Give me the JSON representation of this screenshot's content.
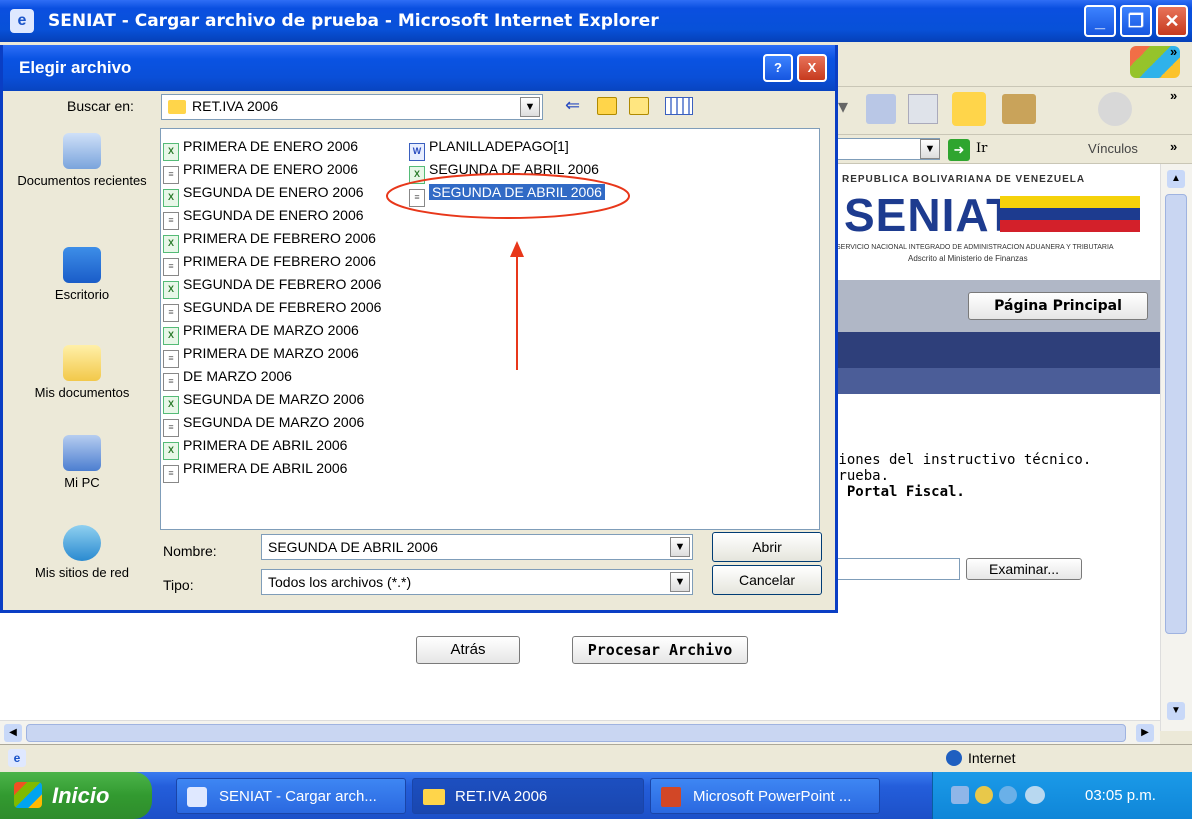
{
  "ie": {
    "title": "SENIAT - Cargar archivo de prueba - Microsoft Internet Explorer",
    "go_label": "Ir",
    "links_label": "Vínculos",
    "status_zone": "Internet"
  },
  "webpage": {
    "banner_top": "REPUBLICA BOLIVARIANA DE VENEZUELA",
    "banner_logo": "SENIAT",
    "banner_sub": "SERVICIO NACIONAL INTEGRADO DE ADMINISTRACION ADUANERA Y TRIBUTARIA",
    "banner_sub2": "Adscrito al Ministerio de Finanzas",
    "main_button": "Página Principal",
    "text_line1": "ciones del instructivo técnico.",
    "text_line2": "prueba.",
    "text_line3": "l Portal Fiscal.",
    "examinar_button": "Examinar...",
    "back_button": "Atrás",
    "process_button": "Procesar Archivo"
  },
  "dialog": {
    "title": "Elegir archivo",
    "help": "?",
    "close": "X",
    "lookin_label": "Buscar en:",
    "lookin_value": "RET.IVA 2006",
    "places": [
      {
        "label": "Documentos recientes"
      },
      {
        "label": "Escritorio"
      },
      {
        "label": "Mis documentos"
      },
      {
        "label": "Mi PC"
      },
      {
        "label": "Mis sitios de red"
      }
    ],
    "files_col1": [
      {
        "name": "PRIMERA DE ENERO 2006",
        "type": "xls"
      },
      {
        "name": "PRIMERA DE ENERO 2006",
        "type": "txt"
      },
      {
        "name": "SEGUNDA DE ENERO 2006",
        "type": "xls"
      },
      {
        "name": "SEGUNDA DE ENERO 2006",
        "type": "txt"
      },
      {
        "name": "PRIMERA DE FEBRERO 2006",
        "type": "xls"
      },
      {
        "name": "PRIMERA DE FEBRERO 2006",
        "type": "txt"
      },
      {
        "name": "SEGUNDA DE FEBRERO 2006",
        "type": "xls"
      },
      {
        "name": "SEGUNDA DE FEBRERO 2006",
        "type": "txt"
      },
      {
        "name": "PRIMERA DE MARZO 2006",
        "type": "xls"
      },
      {
        "name": "PRIMERA DE MARZO 2006",
        "type": "txt"
      },
      {
        "name": "DE MARZO 2006",
        "type": "txt"
      },
      {
        "name": "SEGUNDA DE MARZO 2006",
        "type": "xls"
      },
      {
        "name": "SEGUNDA DE MARZO 2006",
        "type": "txt"
      },
      {
        "name": "PRIMERA DE ABRIL 2006",
        "type": "xls"
      },
      {
        "name": "PRIMERA DE ABRIL 2006",
        "type": "txt"
      }
    ],
    "files_col2": [
      {
        "name": "PLANILLADEPAGO[1]",
        "type": "doc"
      },
      {
        "name": "SEGUNDA DE ABRIL 2006",
        "type": "xls"
      },
      {
        "name": "SEGUNDA DE ABRIL 2006",
        "type": "txt",
        "selected": true
      }
    ],
    "filename_label": "Nombre:",
    "filename_value": "SEGUNDA DE ABRIL 2006",
    "filetype_label": "Tipo:",
    "filetype_value": "Todos los archivos (*.*)",
    "open_button": "Abrir",
    "cancel_button": "Cancelar",
    "annotation_color": "#e8371a"
  },
  "taskbar": {
    "start": "Inicio",
    "tasks": [
      {
        "label": "SENIAT - Cargar arch..."
      },
      {
        "label": "RET.IVA 2006"
      },
      {
        "label": "Microsoft PowerPoint ..."
      }
    ],
    "clock": "03:05 p.m."
  }
}
